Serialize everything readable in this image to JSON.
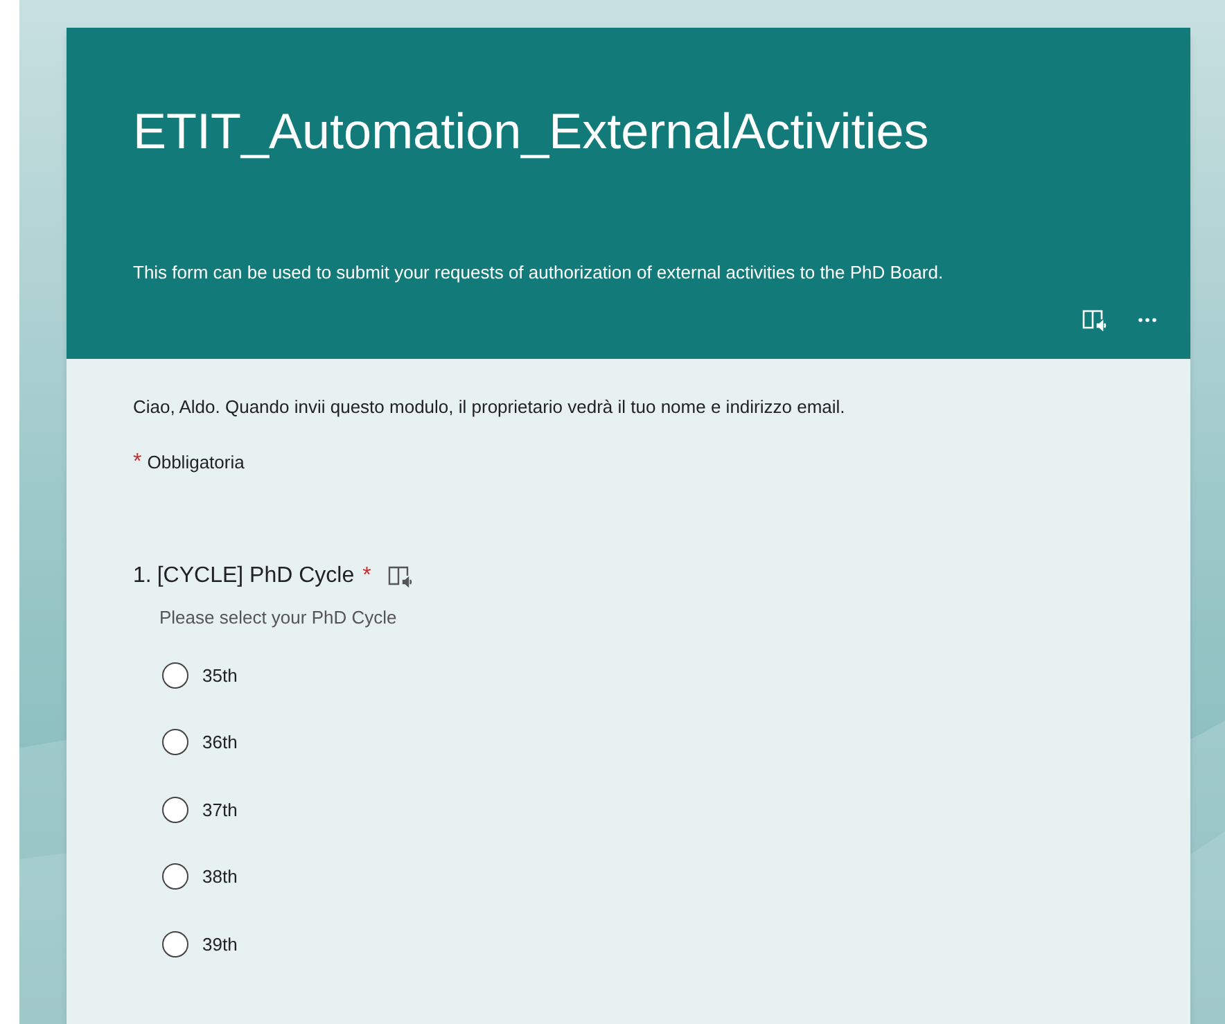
{
  "form": {
    "title": "ETIT_Automation_ExternalActivities",
    "description": "This form can be used to submit your requests of authorization of external activities to the PhD Board.",
    "notice": "Ciao, Aldo. Quando invii questo modulo, il proprietario vedrà il tuo nome e indirizzo email.",
    "required_mark": "*",
    "required_legend": "Obbligatoria"
  },
  "questions": [
    {
      "number": "1.",
      "title": "[CYCLE] PhD Cycle",
      "required": true,
      "subtitle": "Please select your PhD Cycle",
      "options": [
        {
          "label": "35th",
          "selected": false
        },
        {
          "label": "36th",
          "selected": false
        },
        {
          "label": "37th",
          "selected": false
        },
        {
          "label": "38th",
          "selected": false
        },
        {
          "label": "39th",
          "selected": false
        }
      ]
    }
  ]
}
